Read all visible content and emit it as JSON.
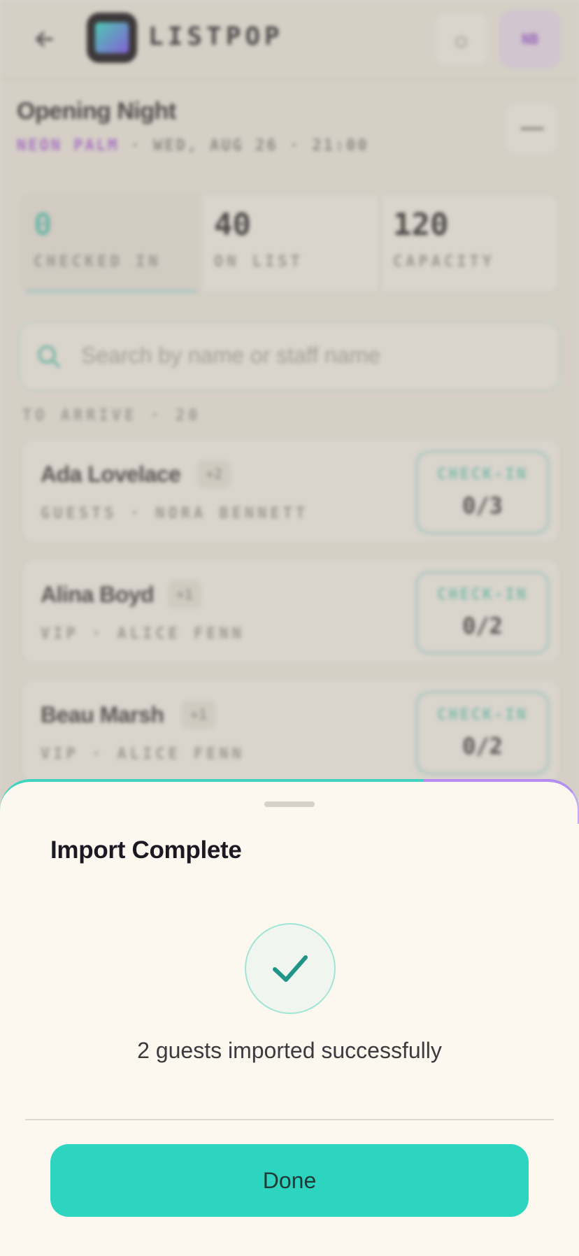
{
  "header": {
    "app_name": "LISTPOP",
    "avatar_initials": "NB"
  },
  "event": {
    "title": "Opening Night",
    "venue": "NEON PALM",
    "meta": "· WED, AUG 26 · 21:00"
  },
  "stats": [
    {
      "value": "0",
      "label": "CHECKED IN"
    },
    {
      "value": "40",
      "label": "ON LIST"
    },
    {
      "value": "120",
      "label": "CAPACITY"
    }
  ],
  "search": {
    "placeholder": "Search by name or staff name"
  },
  "section": {
    "label": "TO ARRIVE · 20"
  },
  "guests": [
    {
      "name": "Ada Lovelace",
      "plus": "+2",
      "meta": "GUESTS · NORA BENNETT",
      "checkin_label": "CHECK-IN",
      "count": "0/3"
    },
    {
      "name": "Alina Boyd",
      "plus": "+1",
      "meta": "VIP · ALICE FENN",
      "checkin_label": "CHECK-IN",
      "count": "0/2"
    },
    {
      "name": "Beau Marsh",
      "plus": "+1",
      "meta": "VIP · ALICE FENN",
      "checkin_label": "CHECK-IN",
      "count": "0/2"
    }
  ],
  "sheet": {
    "title": "Import Complete",
    "message": "2 guests imported successfully",
    "done_label": "Done"
  },
  "colors": {
    "accent": "#2dd4bf",
    "brand_purple": "#b066e3",
    "sheet_bg": "#fcf8ef"
  },
  "icons": {
    "back": "arrow-left-icon",
    "settings": "sun-icon",
    "menu": "minus-icon",
    "search": "search-icon",
    "success": "check-icon"
  }
}
